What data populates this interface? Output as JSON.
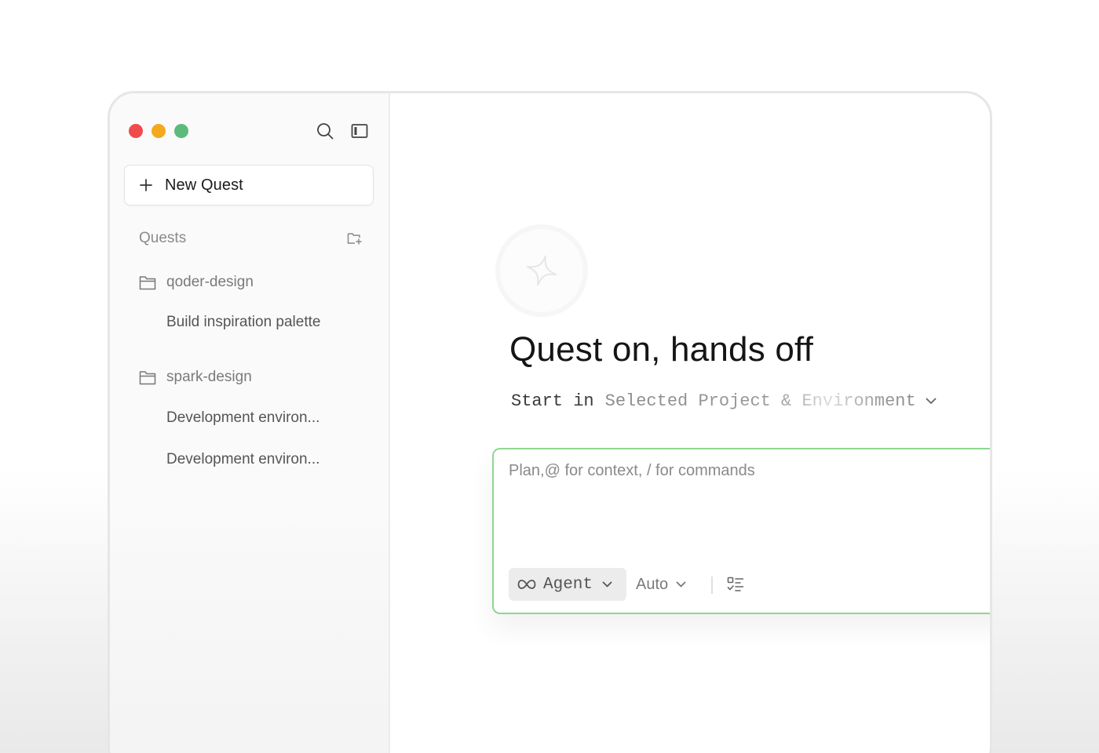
{
  "sidebar": {
    "new_quest_label": "New Quest",
    "section_title": "Quests",
    "folders": [
      {
        "name": "qoder-design",
        "items": [
          "Build inspiration palette"
        ]
      },
      {
        "name": "spark-design",
        "items": [
          "Development environ...",
          "Development environ..."
        ]
      }
    ]
  },
  "main": {
    "headline": "Quest on, hands off",
    "start_label": "Start in",
    "environment_value": "Selected Project & Environment",
    "composer": {
      "placeholder": "Plan,@ for context, / for commands",
      "agent_label": "Agent",
      "mode_label": "Auto"
    }
  },
  "colors": {
    "traffic_red": "#f04b4c",
    "traffic_yellow": "#f4a91d",
    "traffic_green": "#5cbb7b",
    "composer_border": "#8fd68f"
  },
  "icons": {
    "search": "search-icon",
    "sidebar_toggle": "sidebar-toggle-icon",
    "plus": "plus-icon",
    "new_folder": "new-folder-icon",
    "folder": "folder-icon",
    "logo": "sparkle-logo-icon",
    "chevron": "chevron-down-icon",
    "infinity": "infinity-icon",
    "checklist": "checklist-icon"
  }
}
